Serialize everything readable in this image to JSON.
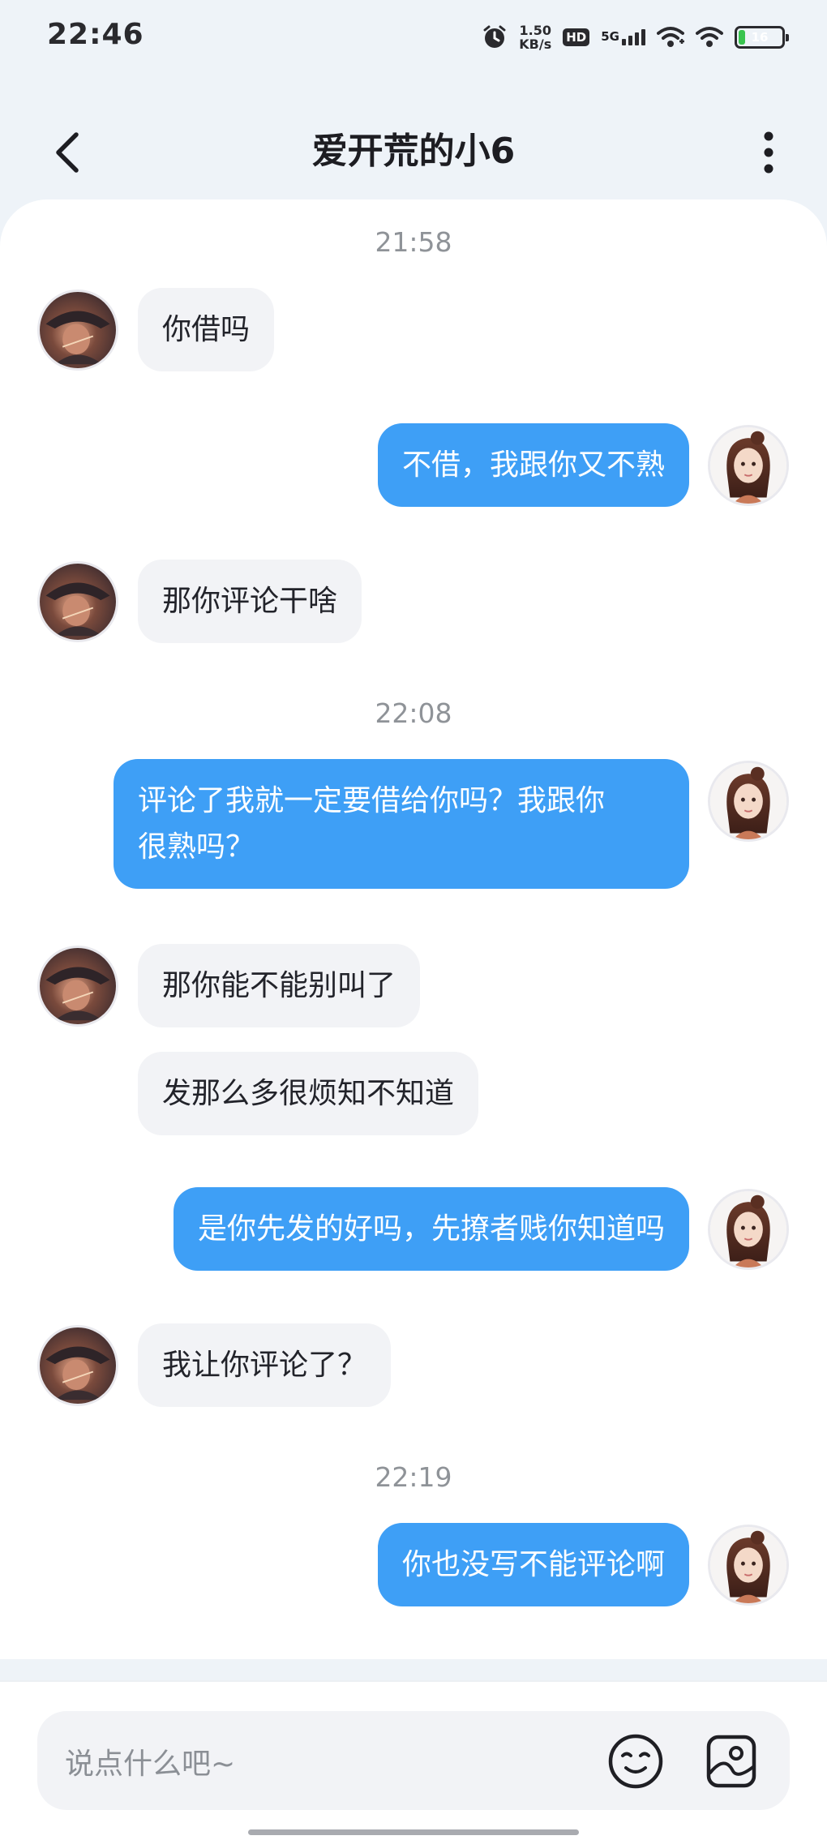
{
  "status_bar": {
    "time": "22:46",
    "net_speed_value": "1.50",
    "net_speed_unit": "KB/s",
    "hd_label": "HD",
    "network_label": "5G",
    "battery_level": "16",
    "battery_fraction": 0.16,
    "icons": [
      "alarm-icon",
      "hd-icon",
      "5g-signal-icon",
      "wifi-signal-icon",
      "wifi-icon",
      "battery-icon"
    ]
  },
  "header": {
    "title": "爱开荒的小6",
    "back_icon": "chevron-left-icon",
    "more_icon": "more-vertical-icon"
  },
  "chat": {
    "timestamps": [
      "21:58",
      "22:08",
      "22:19"
    ],
    "messages": [
      {
        "from": "other",
        "text": "你借吗"
      },
      {
        "from": "me",
        "text": "不借，我跟你又不熟"
      },
      {
        "from": "other",
        "text": "那你评论干啥"
      },
      {
        "from": "me",
        "line1": "评论了我就一定要借给你吗？我跟你",
        "line2": "很熟吗？"
      },
      {
        "from": "other",
        "text": "那你能不能别叫了"
      },
      {
        "from": "other",
        "text": "发那么多很烦知不知道"
      },
      {
        "from": "me",
        "text": "是你先发的好吗，先撩者贱你知道吗"
      },
      {
        "from": "other",
        "text": "我让你评论了？"
      },
      {
        "from": "me",
        "text": "你也没写不能评论啊"
      }
    ]
  },
  "input": {
    "placeholder": "说点什么吧~",
    "emoji_icon": "emoji-icon",
    "sticker_icon": "sticker-icon"
  },
  "colors": {
    "outgoing_bubble": "#3e9ff6",
    "incoming_bubble": "#f2f3f6",
    "background": "#eef3f8"
  }
}
